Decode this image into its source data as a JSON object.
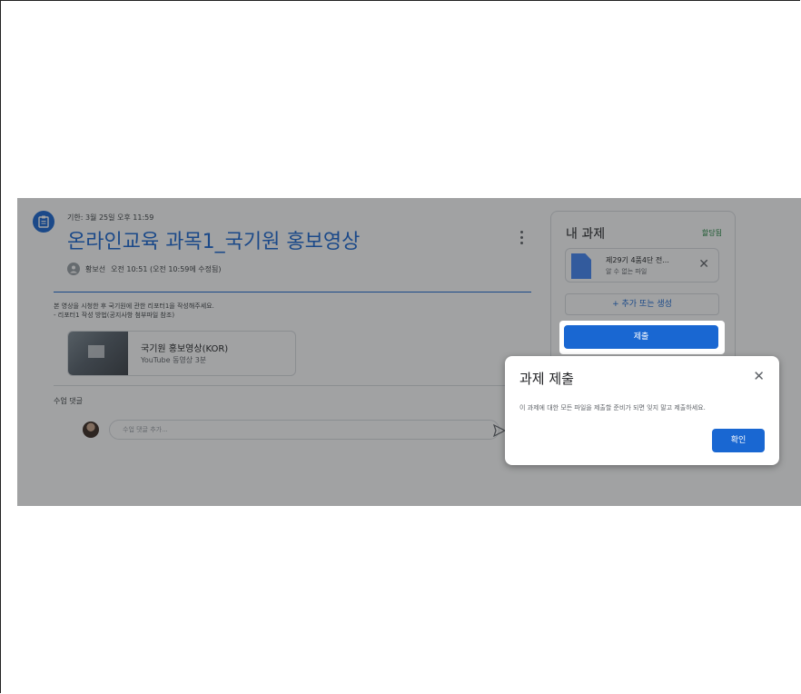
{
  "assignment": {
    "due": "기한: 3월 25일 오후 11:59",
    "title": "온라인교육 과목1_국기원 홍보영상",
    "author": "황보선",
    "posted": "오전 10:51 (오전 10:59에 수정됨)",
    "description_lines": [
      "본 영상을 시청한 후 국기원에 관한 리포터1을 작성해주세요.",
      "- 리포터1 작성 방법(공지사항 첨부파일 참조)"
    ],
    "attachment": {
      "title": "국기원 홍보영상(KOR)",
      "subtitle": "YouTube 동영상 3분"
    }
  },
  "comments": {
    "label": "수업 댓글",
    "input_placeholder": "수업 댓글 추가..."
  },
  "my_work": {
    "title": "내 과제",
    "status": "할당됨",
    "file": {
      "name": "제29기 4품4단 전...",
      "type": "알 수 없는 파일"
    },
    "add_label": "+ 추가 또는 생성",
    "submit_label": "제출"
  },
  "dialog": {
    "title": "과제 제출",
    "message": "이 과제에 대한 모든 파일을 제출할 준비가 되면 잊지 말고 제출하세요.",
    "confirm_label": "확인"
  },
  "colors": {
    "accent": "#1967d2",
    "status_green": "#188038",
    "overlay": "rgba(32,33,36,0.42)"
  },
  "icons": {
    "assignment": "assignment-icon",
    "more": "more-vert-icon",
    "file": "file-icon",
    "close": "close-icon",
    "send": "send-icon"
  }
}
